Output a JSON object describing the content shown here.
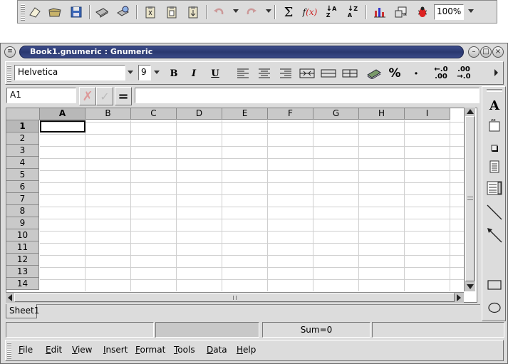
{
  "toolbar": {
    "zoom_value": "100%",
    "items": [
      "new-icon",
      "open-icon",
      "save-icon",
      "print-icon",
      "print-preview-icon",
      "cut-icon",
      "copy-icon",
      "paste-icon",
      "undo-icon",
      "redo-icon",
      "sum-icon",
      "function-icon",
      "sort-ascending-icon",
      "sort-descending-icon",
      "chart-icon",
      "insert-object-icon",
      "bug-icon"
    ]
  },
  "window": {
    "title": "Book1.gnumeric : Gnumeric"
  },
  "format_toolbar": {
    "font_name": "Helvetica",
    "font_size": "9",
    "bold_label": "B",
    "italic_label": "I",
    "underline_label": "U",
    "percent_label": "%",
    "comma_label": "·",
    "inc_decimals_label": "←.0 .00",
    "dec_decimals_label": ".00 →.0"
  },
  "edit_line": {
    "cell_ref": "A1",
    "equals_label": "=",
    "expression": ""
  },
  "grid": {
    "columns": [
      "A",
      "B",
      "C",
      "D",
      "E",
      "F",
      "G",
      "H",
      "I"
    ],
    "rows": [
      "1",
      "2",
      "3",
      "4",
      "5",
      "6",
      "7",
      "8",
      "9",
      "10",
      "11",
      "12",
      "13",
      "14"
    ],
    "selected_column": "A",
    "selected_row": "1"
  },
  "object_toolbar": {
    "text_label": "A"
  },
  "sheet_tabs": [
    "Sheet1"
  ],
  "status": {
    "sum": "Sum=0"
  },
  "menu": {
    "items": [
      {
        "label": "File"
      },
      {
        "label": "Edit"
      },
      {
        "label": "View"
      },
      {
        "label": "Insert"
      },
      {
        "label": "Format"
      },
      {
        "label": "Tools"
      },
      {
        "label": "Data"
      },
      {
        "label": "Help"
      }
    ]
  }
}
